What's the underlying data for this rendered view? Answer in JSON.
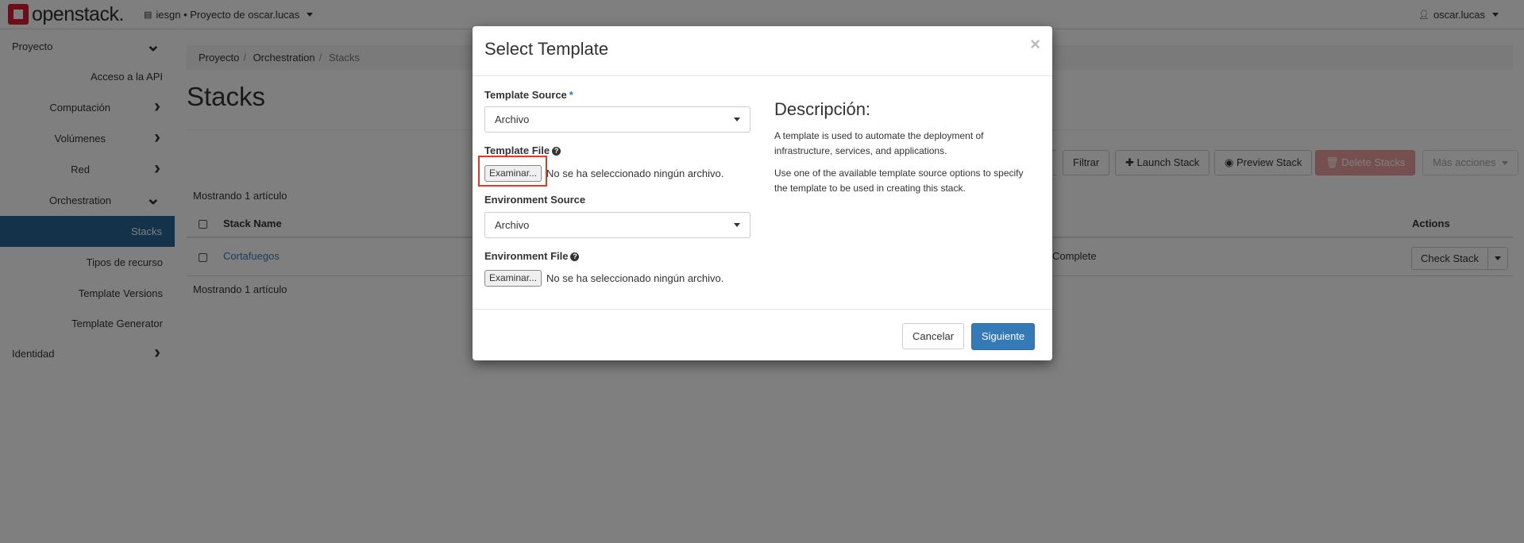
{
  "topbar": {
    "logo_text": "openstack.",
    "project_selector": "iesgn • Proyecto de oscar.lucas",
    "user": "oscar.lucas"
  },
  "sidebar": {
    "items": [
      {
        "label": "Proyecto",
        "level": 0,
        "chevron": "down"
      },
      {
        "label": "Acceso a la API",
        "level": 2
      },
      {
        "label": "Computación",
        "level": 1,
        "chevron": "right"
      },
      {
        "label": "Volúmenes",
        "level": 1,
        "chevron": "right"
      },
      {
        "label": "Red",
        "level": 1,
        "chevron": "right"
      },
      {
        "label": "Orchestration",
        "level": 1,
        "chevron": "down"
      },
      {
        "label": "Stacks",
        "level": 2,
        "active": true
      },
      {
        "label": "Tipos de recurso",
        "level": 2
      },
      {
        "label": "Template Versions",
        "level": 2
      },
      {
        "label": "Template Generator",
        "level": 2
      },
      {
        "label": "Identidad",
        "level": 0,
        "chevron": "right"
      }
    ]
  },
  "breadcrumb": [
    "Proyecto",
    "Orchestration",
    "Stacks"
  ],
  "page_title": "Stacks",
  "toolbar": {
    "filter": "Filtrar",
    "launch": "Launch Stack",
    "preview": "Preview Stack",
    "delete": "Delete Stacks",
    "more": "Más acciones"
  },
  "table": {
    "count_text": "Mostrando 1 artículo",
    "headers": {
      "name": "Stack Name",
      "actions": "Actions"
    },
    "rows": [
      {
        "name": "Cortafuegos",
        "status": "Complete",
        "action": "Check Stack"
      }
    ]
  },
  "modal": {
    "title": "Select Template",
    "close": "×",
    "template_source_label": "Template Source",
    "required_mark": "*",
    "template_source_value": "Archivo",
    "template_file_label": "Template File",
    "browse_label": "Examinar...",
    "no_file_text": "No se ha seleccionado ningún archivo.",
    "environment_source_label": "Environment Source",
    "environment_source_value": "Archivo",
    "environment_file_label": "Environment File",
    "description_title": "Descripción:",
    "description_p1": "A template is used to automate the deployment of infrastructure, services, and applications.",
    "description_p2": "Use one of the available template source options to specify the template to be used in creating this stack.",
    "cancel": "Cancelar",
    "next": "Siguiente"
  },
  "colors": {
    "accent": "#337ab7",
    "active_nav": "#2a6496",
    "danger": "#d9534f",
    "highlight": "#e53a1f",
    "brand": "#da1a32"
  }
}
